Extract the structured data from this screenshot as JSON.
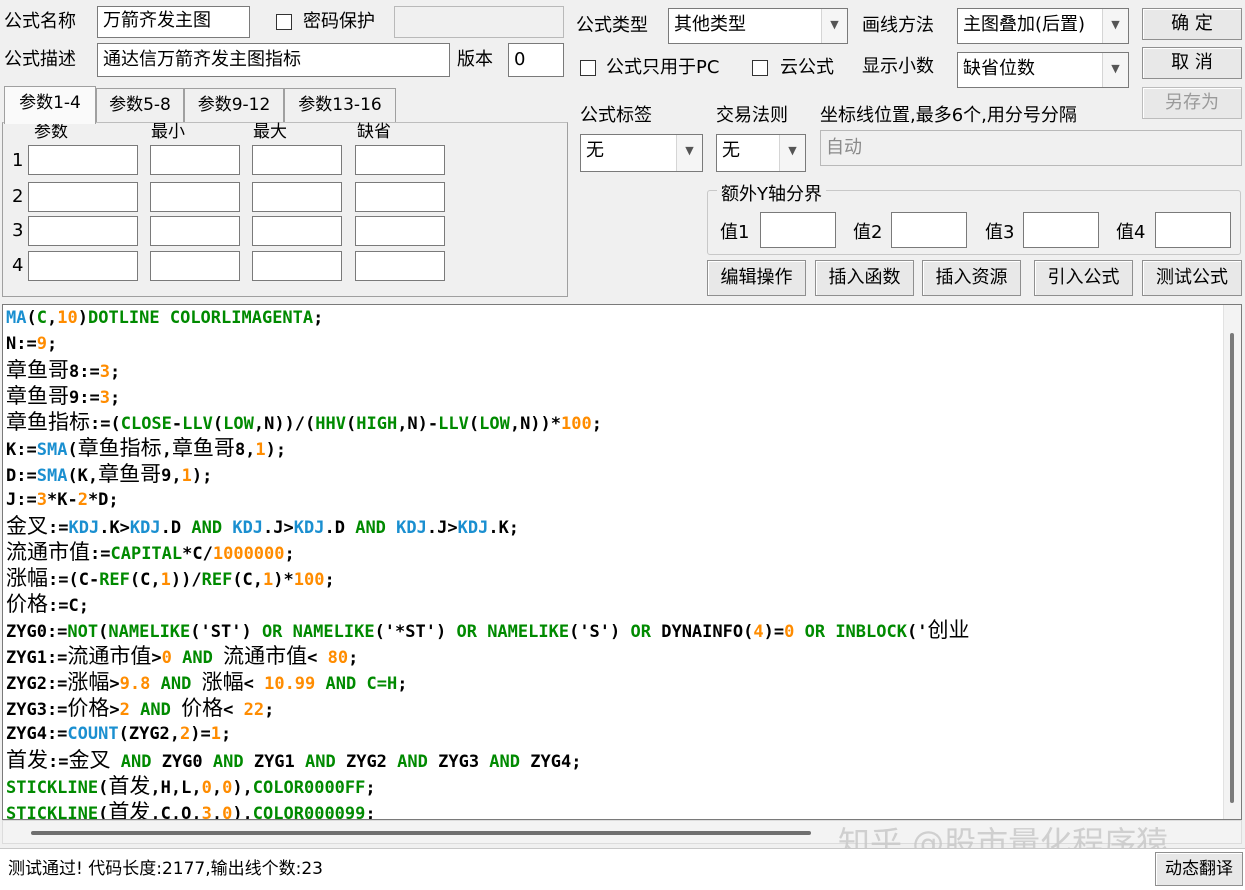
{
  "colors": {
    "background": "#f0f0f0",
    "code_function": "#1a8fd0",
    "code_keyword": "#008a00",
    "code_number": "#ff8c00",
    "code_default": "#000000"
  },
  "header": {
    "formula_name_label": "公式名称",
    "formula_name_value": "万箭齐发主图",
    "password_label": "密码保护",
    "password_checked": false,
    "password_value": "",
    "formula_desc_label": "公式描述",
    "formula_desc_value": "通达信万箭齐发主图指标",
    "version_label": "版本",
    "version_value": "0",
    "formula_type_label": "公式类型",
    "formula_type_value": "其他类型",
    "draw_method_label": "画线方法",
    "draw_method_value": "主图叠加(后置)",
    "pc_only_label": "公式只用于PC",
    "pc_only_checked": false,
    "cloud_label": "云公式",
    "cloud_checked": false,
    "decimals_label": "显示小数",
    "decimals_value": "缺省位数",
    "ok_label": "确  定",
    "cancel_label": "取  消",
    "saveas_label": "另存为"
  },
  "params": {
    "tabs": [
      "参数1-4",
      "参数5-8",
      "参数9-12",
      "参数13-16"
    ],
    "active_tab": 0,
    "columns": [
      "参数",
      "最小",
      "最大",
      "缺省"
    ],
    "rows": [
      "1",
      "2",
      "3",
      "4"
    ]
  },
  "right_panel": {
    "tag_label": "公式标签",
    "tag_value": "无",
    "trade_rule_label": "交易法则",
    "trade_rule_value": "无",
    "axis_label": "坐标线位置,最多6个,用分号分隔",
    "axis_value": "自动",
    "extra_y_label": "额外Y轴分界",
    "values": [
      "值1",
      "值2",
      "值3",
      "值4"
    ],
    "buttons": [
      "编辑操作",
      "插入函数",
      "插入资源",
      "引入公式",
      "测试公式"
    ]
  },
  "code_lines": [
    [
      [
        "f",
        "MA"
      ],
      [
        "p",
        "("
      ],
      [
        "k",
        "C"
      ],
      [
        "p",
        ","
      ],
      [
        "n",
        "10"
      ],
      [
        "p",
        ")"
      ],
      [
        "k",
        "DOTLINE COLORLIMAGENTA"
      ],
      [
        "p",
        ";"
      ]
    ],
    [
      [
        "p",
        "N:="
      ],
      [
        "n",
        "9"
      ],
      [
        "p",
        ";"
      ]
    ],
    [
      [
        "c",
        "章鱼哥"
      ],
      [
        "p",
        "8:="
      ],
      [
        "n",
        "3"
      ],
      [
        "p",
        ";"
      ]
    ],
    [
      [
        "c",
        "章鱼哥"
      ],
      [
        "p",
        "9:="
      ],
      [
        "n",
        "3"
      ],
      [
        "p",
        ";"
      ]
    ],
    [
      [
        "c",
        "章鱼指标"
      ],
      [
        "p",
        ":=("
      ],
      [
        "k",
        "CLOSE"
      ],
      [
        "p",
        "-"
      ],
      [
        "k",
        "LLV"
      ],
      [
        "p",
        "("
      ],
      [
        "k",
        "LOW"
      ],
      [
        "p",
        ",N))/("
      ],
      [
        "k",
        "HHV"
      ],
      [
        "p",
        "("
      ],
      [
        "k",
        "HIGH"
      ],
      [
        "p",
        ",N)-"
      ],
      [
        "k",
        "LLV"
      ],
      [
        "p",
        "("
      ],
      [
        "k",
        "LOW"
      ],
      [
        "p",
        ",N))*"
      ],
      [
        "n",
        "100"
      ],
      [
        "p",
        ";"
      ]
    ],
    [
      [
        "p",
        "K:="
      ],
      [
        "f",
        "SMA"
      ],
      [
        "p",
        "("
      ],
      [
        "c",
        "章鱼指标"
      ],
      [
        "p",
        ","
      ],
      [
        "c",
        "章鱼哥"
      ],
      [
        "p",
        "8,"
      ],
      [
        "n",
        "1"
      ],
      [
        "p",
        ");"
      ]
    ],
    [
      [
        "p",
        "D:="
      ],
      [
        "f",
        "SMA"
      ],
      [
        "p",
        "(K,"
      ],
      [
        "c",
        "章鱼哥"
      ],
      [
        "p",
        "9,"
      ],
      [
        "n",
        "1"
      ],
      [
        "p",
        ");"
      ]
    ],
    [
      [
        "p",
        "J:="
      ],
      [
        "n",
        "3"
      ],
      [
        "p",
        "*K-"
      ],
      [
        "n",
        "2"
      ],
      [
        "p",
        "*D;"
      ]
    ],
    [
      [
        "c",
        "金叉"
      ],
      [
        "p",
        ":="
      ],
      [
        "f",
        "KDJ"
      ],
      [
        "p",
        ".K>"
      ],
      [
        "f",
        "KDJ"
      ],
      [
        "p",
        ".D "
      ],
      [
        "k",
        "AND"
      ],
      [
        "p",
        " "
      ],
      [
        "f",
        "KDJ"
      ],
      [
        "p",
        ".J>"
      ],
      [
        "f",
        "KDJ"
      ],
      [
        "p",
        ".D "
      ],
      [
        "k",
        "AND"
      ],
      [
        "p",
        " "
      ],
      [
        "f",
        "KDJ"
      ],
      [
        "p",
        ".J>"
      ],
      [
        "f",
        "KDJ"
      ],
      [
        "p",
        ".K;"
      ]
    ],
    [
      [
        "c",
        "流通市值"
      ],
      [
        "p",
        ":="
      ],
      [
        "k",
        "CAPITAL"
      ],
      [
        "p",
        "*C/"
      ],
      [
        "n",
        "1000000"
      ],
      [
        "p",
        ";"
      ]
    ],
    [
      [
        "c",
        "涨幅"
      ],
      [
        "p",
        ":=(C-"
      ],
      [
        "k",
        "REF"
      ],
      [
        "p",
        "(C,"
      ],
      [
        "n",
        "1"
      ],
      [
        "p",
        "))/"
      ],
      [
        "k",
        "REF"
      ],
      [
        "p",
        "(C,"
      ],
      [
        "n",
        "1"
      ],
      [
        "p",
        ")*"
      ],
      [
        "n",
        "100"
      ],
      [
        "p",
        ";"
      ]
    ],
    [
      [
        "c",
        "价格"
      ],
      [
        "p",
        ":=C;"
      ]
    ],
    [
      [
        "p",
        "ZYG0:="
      ],
      [
        "k",
        "NOT"
      ],
      [
        "p",
        "("
      ],
      [
        "k",
        "NAMELIKE"
      ],
      [
        "p",
        "('ST') "
      ],
      [
        "k",
        "OR"
      ],
      [
        "p",
        " "
      ],
      [
        "k",
        "NAMELIKE"
      ],
      [
        "p",
        "('*ST') "
      ],
      [
        "k",
        "OR"
      ],
      [
        "p",
        " "
      ],
      [
        "k",
        "NAMELIKE"
      ],
      [
        "p",
        "('S') "
      ],
      [
        "k",
        "OR"
      ],
      [
        "p",
        " DYNAINFO("
      ],
      [
        "n",
        "4"
      ],
      [
        "p",
        ")="
      ],
      [
        "n",
        "0"
      ],
      [
        "p",
        " "
      ],
      [
        "k",
        "OR"
      ],
      [
        "p",
        " "
      ],
      [
        "k",
        "INBLOCK"
      ],
      [
        "p",
        "('"
      ],
      [
        "c",
        "创业"
      ]
    ],
    [
      [
        "p",
        "ZYG1:="
      ],
      [
        "c",
        "流通市值"
      ],
      [
        "p",
        ">"
      ],
      [
        "n",
        "0"
      ],
      [
        "p",
        " "
      ],
      [
        "k",
        "AND"
      ],
      [
        "p",
        " "
      ],
      [
        "c",
        "流通市值"
      ],
      [
        "p",
        "< "
      ],
      [
        "n",
        "80"
      ],
      [
        "p",
        ";"
      ]
    ],
    [
      [
        "p",
        "ZYG2:="
      ],
      [
        "c",
        "涨幅"
      ],
      [
        "p",
        ">"
      ],
      [
        "n",
        "9.8"
      ],
      [
        "p",
        " "
      ],
      [
        "k",
        "AND"
      ],
      [
        "p",
        " "
      ],
      [
        "c",
        "涨幅"
      ],
      [
        "p",
        "< "
      ],
      [
        "n",
        "10.99"
      ],
      [
        "p",
        " "
      ],
      [
        "k",
        "AND"
      ],
      [
        "p",
        " "
      ],
      [
        "k",
        "C=H"
      ],
      [
        "p",
        ";"
      ]
    ],
    [
      [
        "p",
        "ZYG3:="
      ],
      [
        "c",
        "价格"
      ],
      [
        "p",
        ">"
      ],
      [
        "n",
        "2"
      ],
      [
        "p",
        " "
      ],
      [
        "k",
        "AND"
      ],
      [
        "p",
        " "
      ],
      [
        "c",
        "价格"
      ],
      [
        "p",
        "< "
      ],
      [
        "n",
        "22"
      ],
      [
        "p",
        ";"
      ]
    ],
    [
      [
        "p",
        "ZYG4:="
      ],
      [
        "f",
        "COUNT"
      ],
      [
        "p",
        "(ZYG2,"
      ],
      [
        "n",
        "2"
      ],
      [
        "p",
        ")="
      ],
      [
        "n",
        "1"
      ],
      [
        "p",
        ";"
      ]
    ],
    [
      [
        "c",
        "首发"
      ],
      [
        "p",
        ":="
      ],
      [
        "c",
        "金叉"
      ],
      [
        "p",
        " "
      ],
      [
        "k",
        "AND"
      ],
      [
        "p",
        " ZYG0 "
      ],
      [
        "k",
        "AND"
      ],
      [
        "p",
        " ZYG1 "
      ],
      [
        "k",
        "AND"
      ],
      [
        "p",
        " ZYG2 "
      ],
      [
        "k",
        "AND"
      ],
      [
        "p",
        " ZYG3 "
      ],
      [
        "k",
        "AND"
      ],
      [
        "p",
        " ZYG4;"
      ]
    ],
    [
      [
        "k",
        "STICKLINE"
      ],
      [
        "p",
        "("
      ],
      [
        "c",
        "首发"
      ],
      [
        "p",
        ",H,L,"
      ],
      [
        "n",
        "0"
      ],
      [
        "p",
        ","
      ],
      [
        "n",
        "0"
      ],
      [
        "p",
        "),"
      ],
      [
        "k",
        "COLOR0000FF"
      ],
      [
        "p",
        ";"
      ]
    ],
    [
      [
        "k",
        "STICKLINE"
      ],
      [
        "p",
        "("
      ],
      [
        "c",
        "首发"
      ],
      [
        "p",
        ",C,O,"
      ],
      [
        "n",
        "3"
      ],
      [
        "p",
        ","
      ],
      [
        "n",
        "0"
      ],
      [
        "p",
        "),"
      ],
      [
        "k",
        "COLOR000099"
      ],
      [
        "p",
        ";"
      ]
    ]
  ],
  "status": {
    "message": "测试通过! 代码长度:2177,输出线个数:23",
    "translate_label": "动态翻译"
  },
  "watermark": "知乎 @股市量化程序猿"
}
